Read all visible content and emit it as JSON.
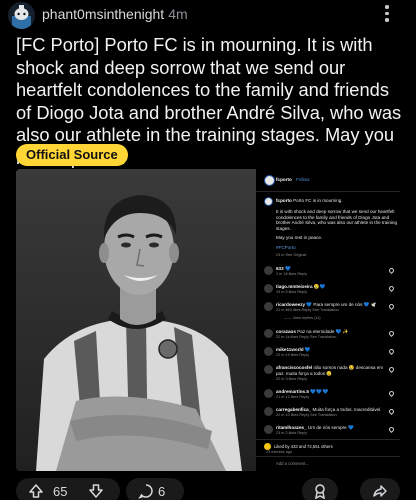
{
  "post": {
    "username": "phant0msinthenight",
    "time": "4m",
    "title": "[FC Porto] Porto FC is in mourning. It is with shock and deep sorrow that we send our heartfelt condolences to the family and friends of Diogo Jota and brother André Silva, who was also our athlete in the training stages. May you rest in peace.",
    "flair": "Official Source",
    "flair_color": "#ffd635"
  },
  "instagram": {
    "account": "fcporto",
    "follow": "Follow",
    "caption_user": "fcporto",
    "caption_first": "Porto FC is in mourning.",
    "caption_body": [
      "It is with shock and deep sorrow that we send our heartfelt",
      "condolences to the family and friends of Diogo Jota and",
      "brother André Silva, who was also our athlete in the training",
      "stages."
    ],
    "caption_end": "May you rest in peace.",
    "hashtag": "#FCPorto",
    "caption_meta": "23 m  See Original",
    "comments": [
      {
        "user": "633",
        "text": "💙",
        "meta": "1 m  18 likes  Reply"
      },
      {
        "user": "tiago.mmteixeira",
        "text": "😢💙",
        "meta": "19 m  5 likes  Reply"
      },
      {
        "user": "ricardoweezy",
        "text": "💙 Para sempre um de nós 💙 🕊️",
        "meta": "21 m  863 likes  Reply  See Translation"
      },
      {
        "user": "",
        "text": "—— View replies (11)",
        "meta": ""
      },
      {
        "user": "corazaos",
        "text": "Paz na eternidade 💙 ✨",
        "meta": "22 m  1k likes  Reply  See Translation"
      },
      {
        "user": "mike11world",
        "text": "💙",
        "meta": "22 m  19 likes  Reply"
      },
      {
        "user": "afranciscocosfel",
        "text": "não somos nada 😢 descansa em paz. muita força a todos 😢",
        "meta": "22 m  3 likes  Reply"
      },
      {
        "user": "andremartins.5",
        "text": "💙💙 💙",
        "meta": "21 m  12 likes  Reply"
      },
      {
        "user": "carregabenfica_",
        "text": "Muita força a todos. Inacreditável.",
        "meta": "22 m  10 likes  Reply  See Translation"
      },
      {
        "user": "ritamlhoazes_",
        "text": "Um de nós sempre 💙",
        "meta": "23 m  2 likes  Reply"
      }
    ],
    "liked_by": "Liked by 433 and 72,551 others",
    "posted": "23 minutes ago",
    "add_comment": "Add a comment..."
  },
  "actions": {
    "upvotes": "65",
    "comments": "6"
  },
  "colors": {
    "background": "#000000",
    "flair": "#ffd635",
    "pill": "#1a1a1b",
    "porto_blue": "#1e4f9c"
  }
}
